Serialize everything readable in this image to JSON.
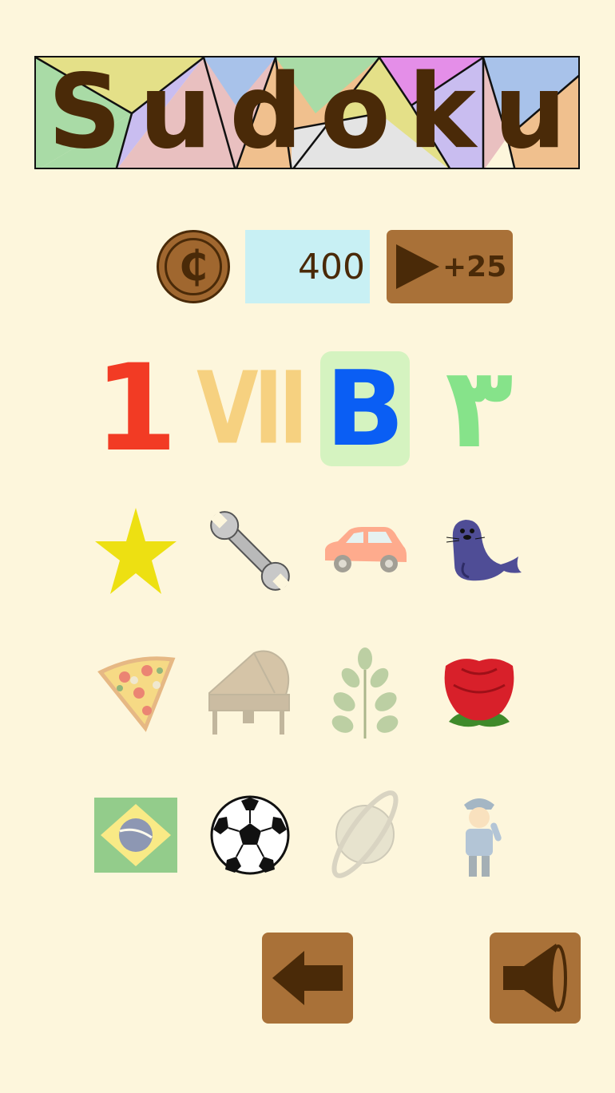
{
  "app": {
    "title": "Sudoku"
  },
  "colors": {
    "background": "#fdf6dc",
    "brown_dark": "#4a2a08",
    "brown_button": "#a97138",
    "coin_fill": "#a0672f",
    "coin_count_bg": "#c8f0f4",
    "selected_bg": "#d5f3c0"
  },
  "coins": {
    "symbol": "₵",
    "count": "400"
  },
  "reward_ad": {
    "bonus": "+25",
    "icon": "play-icon"
  },
  "number_styles": [
    {
      "name": "arabic-numeral",
      "glyph": "1",
      "color": "#f23b24",
      "selected": false,
      "faded": false
    },
    {
      "name": "roman-numeral",
      "glyph": "VII",
      "color": "#f5c86a",
      "selected": false,
      "faded": true
    },
    {
      "name": "latin-letter",
      "glyph": "B",
      "color": "#0a5ef4",
      "selected": true,
      "faded": false
    },
    {
      "name": "eastern-arabic-numeral",
      "glyph": "٣",
      "color": "#86e38a",
      "selected": false,
      "faded": true
    }
  ],
  "theme_rows": [
    [
      {
        "icon": "star-icon",
        "faded": false
      },
      {
        "icon": "wrench-icon",
        "faded": false
      },
      {
        "icon": "car-icon",
        "faded": true
      },
      {
        "icon": "seal-icon",
        "faded": false
      }
    ],
    [
      {
        "icon": "pizza-icon",
        "faded": true
      },
      {
        "icon": "piano-icon",
        "faded": true
      },
      {
        "icon": "leaf-icon",
        "faded": true
      },
      {
        "icon": "rose-icon",
        "faded": false
      }
    ],
    [
      {
        "icon": "brazil-flag-icon",
        "faded": true
      },
      {
        "icon": "soccer-ball-icon",
        "faded": false
      },
      {
        "icon": "planet-icon",
        "faded": true
      },
      {
        "icon": "police-officer-icon",
        "faded": true
      }
    ]
  ],
  "footer": {
    "back_icon": "back-arrow-icon",
    "sound_icon": "speaker-icon"
  }
}
